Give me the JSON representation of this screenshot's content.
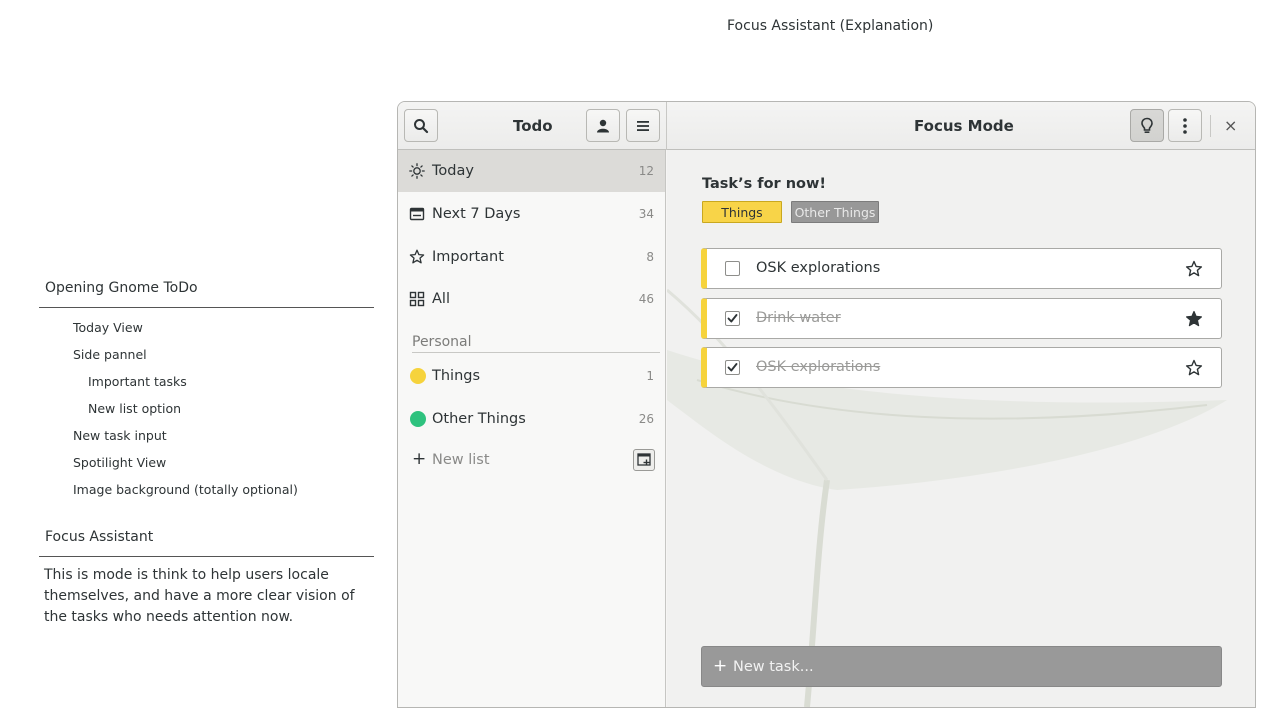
{
  "page": {
    "heading": "Focus Assistant (Explanation)"
  },
  "notes": {
    "section1_title": "Opening Gnome ToDo",
    "items": [
      {
        "text": "Today View",
        "level": 1
      },
      {
        "text": "Side pannel",
        "level": 1
      },
      {
        "text": "Important tasks",
        "level": 2
      },
      {
        "text": "New list option",
        "level": 2
      },
      {
        "text": "New task input",
        "level": 1
      },
      {
        "text": "Spotilight View",
        "level": 1
      },
      {
        "text": "Image background (totally optional)",
        "level": 1
      }
    ],
    "section2_title": "Focus Assistant",
    "description": "This is mode is think to help users locale themselves, and have a more clear vision of the tasks who needs attention now."
  },
  "window": {
    "sidebar_title": "Todo",
    "content_title": "Focus Mode",
    "close_glyph": "×",
    "icons": {
      "search": "search-icon",
      "user": "user-icon",
      "menu": "hamburger-menu-icon",
      "focus": "lightbulb-icon",
      "more": "vertical-dots-icon",
      "close": "close-icon"
    }
  },
  "sidebar": {
    "items": [
      {
        "label": "Today",
        "count": "12",
        "icon": "sun-icon",
        "selected": true
      },
      {
        "label": "Next 7 Days",
        "count": "34",
        "icon": "calendar-icon",
        "selected": false
      },
      {
        "label": "Important",
        "count": "8",
        "icon": "star-outline-icon",
        "selected": false
      },
      {
        "label": "All",
        "count": "46",
        "icon": "grid-icon",
        "selected": false
      }
    ],
    "section_label": "Personal",
    "lists": [
      {
        "label": "Things",
        "count": "1",
        "color": "#f6d33c"
      },
      {
        "label": "Other Things",
        "count": "26",
        "color": "#2ec27e"
      }
    ],
    "new_list_label": "New list"
  },
  "content": {
    "title": "Task’s for now!",
    "tags": [
      {
        "label": "Things",
        "color": "#f8d448"
      },
      {
        "label": "Other Things",
        "color": "#989898"
      }
    ],
    "tasks": [
      {
        "label": "OSK explorations",
        "done": false,
        "starred": false
      },
      {
        "label": "Drink water",
        "done": true,
        "starred": true
      },
      {
        "label": "OSK explorations",
        "done": true,
        "starred": false
      }
    ],
    "new_task_placeholder": "New task..."
  },
  "colors": {
    "accent_yellow": "#f6d33c",
    "accent_green": "#2ec27e",
    "selected_row": "#dcdbd8"
  }
}
